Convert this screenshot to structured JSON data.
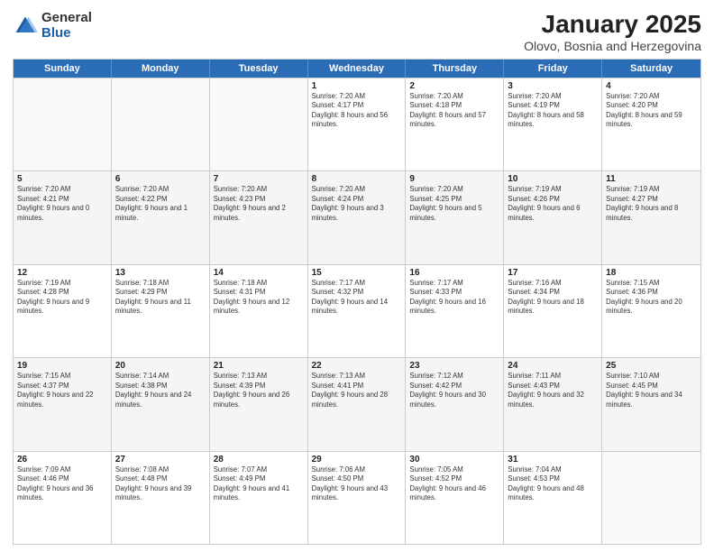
{
  "logo": {
    "general": "General",
    "blue": "Blue"
  },
  "header": {
    "month": "January 2025",
    "location": "Olovo, Bosnia and Herzegovina"
  },
  "days": [
    "Sunday",
    "Monday",
    "Tuesday",
    "Wednesday",
    "Thursday",
    "Friday",
    "Saturday"
  ],
  "weeks": [
    [
      {
        "day": "",
        "text": ""
      },
      {
        "day": "",
        "text": ""
      },
      {
        "day": "",
        "text": ""
      },
      {
        "day": "1",
        "text": "Sunrise: 7:20 AM\nSunset: 4:17 PM\nDaylight: 8 hours and 56 minutes."
      },
      {
        "day": "2",
        "text": "Sunrise: 7:20 AM\nSunset: 4:18 PM\nDaylight: 8 hours and 57 minutes."
      },
      {
        "day": "3",
        "text": "Sunrise: 7:20 AM\nSunset: 4:19 PM\nDaylight: 8 hours and 58 minutes."
      },
      {
        "day": "4",
        "text": "Sunrise: 7:20 AM\nSunset: 4:20 PM\nDaylight: 8 hours and 59 minutes."
      }
    ],
    [
      {
        "day": "5",
        "text": "Sunrise: 7:20 AM\nSunset: 4:21 PM\nDaylight: 9 hours and 0 minutes."
      },
      {
        "day": "6",
        "text": "Sunrise: 7:20 AM\nSunset: 4:22 PM\nDaylight: 9 hours and 1 minute."
      },
      {
        "day": "7",
        "text": "Sunrise: 7:20 AM\nSunset: 4:23 PM\nDaylight: 9 hours and 2 minutes."
      },
      {
        "day": "8",
        "text": "Sunrise: 7:20 AM\nSunset: 4:24 PM\nDaylight: 9 hours and 3 minutes."
      },
      {
        "day": "9",
        "text": "Sunrise: 7:20 AM\nSunset: 4:25 PM\nDaylight: 9 hours and 5 minutes."
      },
      {
        "day": "10",
        "text": "Sunrise: 7:19 AM\nSunset: 4:26 PM\nDaylight: 9 hours and 6 minutes."
      },
      {
        "day": "11",
        "text": "Sunrise: 7:19 AM\nSunset: 4:27 PM\nDaylight: 9 hours and 8 minutes."
      }
    ],
    [
      {
        "day": "12",
        "text": "Sunrise: 7:19 AM\nSunset: 4:28 PM\nDaylight: 9 hours and 9 minutes."
      },
      {
        "day": "13",
        "text": "Sunrise: 7:18 AM\nSunset: 4:29 PM\nDaylight: 9 hours and 11 minutes."
      },
      {
        "day": "14",
        "text": "Sunrise: 7:18 AM\nSunset: 4:31 PM\nDaylight: 9 hours and 12 minutes."
      },
      {
        "day": "15",
        "text": "Sunrise: 7:17 AM\nSunset: 4:32 PM\nDaylight: 9 hours and 14 minutes."
      },
      {
        "day": "16",
        "text": "Sunrise: 7:17 AM\nSunset: 4:33 PM\nDaylight: 9 hours and 16 minutes."
      },
      {
        "day": "17",
        "text": "Sunrise: 7:16 AM\nSunset: 4:34 PM\nDaylight: 9 hours and 18 minutes."
      },
      {
        "day": "18",
        "text": "Sunrise: 7:15 AM\nSunset: 4:36 PM\nDaylight: 9 hours and 20 minutes."
      }
    ],
    [
      {
        "day": "19",
        "text": "Sunrise: 7:15 AM\nSunset: 4:37 PM\nDaylight: 9 hours and 22 minutes."
      },
      {
        "day": "20",
        "text": "Sunrise: 7:14 AM\nSunset: 4:38 PM\nDaylight: 9 hours and 24 minutes."
      },
      {
        "day": "21",
        "text": "Sunrise: 7:13 AM\nSunset: 4:39 PM\nDaylight: 9 hours and 26 minutes."
      },
      {
        "day": "22",
        "text": "Sunrise: 7:13 AM\nSunset: 4:41 PM\nDaylight: 9 hours and 28 minutes."
      },
      {
        "day": "23",
        "text": "Sunrise: 7:12 AM\nSunset: 4:42 PM\nDaylight: 9 hours and 30 minutes."
      },
      {
        "day": "24",
        "text": "Sunrise: 7:11 AM\nSunset: 4:43 PM\nDaylight: 9 hours and 32 minutes."
      },
      {
        "day": "25",
        "text": "Sunrise: 7:10 AM\nSunset: 4:45 PM\nDaylight: 9 hours and 34 minutes."
      }
    ],
    [
      {
        "day": "26",
        "text": "Sunrise: 7:09 AM\nSunset: 4:46 PM\nDaylight: 9 hours and 36 minutes."
      },
      {
        "day": "27",
        "text": "Sunrise: 7:08 AM\nSunset: 4:48 PM\nDaylight: 9 hours and 39 minutes."
      },
      {
        "day": "28",
        "text": "Sunrise: 7:07 AM\nSunset: 4:49 PM\nDaylight: 9 hours and 41 minutes."
      },
      {
        "day": "29",
        "text": "Sunrise: 7:06 AM\nSunset: 4:50 PM\nDaylight: 9 hours and 43 minutes."
      },
      {
        "day": "30",
        "text": "Sunrise: 7:05 AM\nSunset: 4:52 PM\nDaylight: 9 hours and 46 minutes."
      },
      {
        "day": "31",
        "text": "Sunrise: 7:04 AM\nSunset: 4:53 PM\nDaylight: 9 hours and 48 minutes."
      },
      {
        "day": "",
        "text": ""
      }
    ]
  ]
}
